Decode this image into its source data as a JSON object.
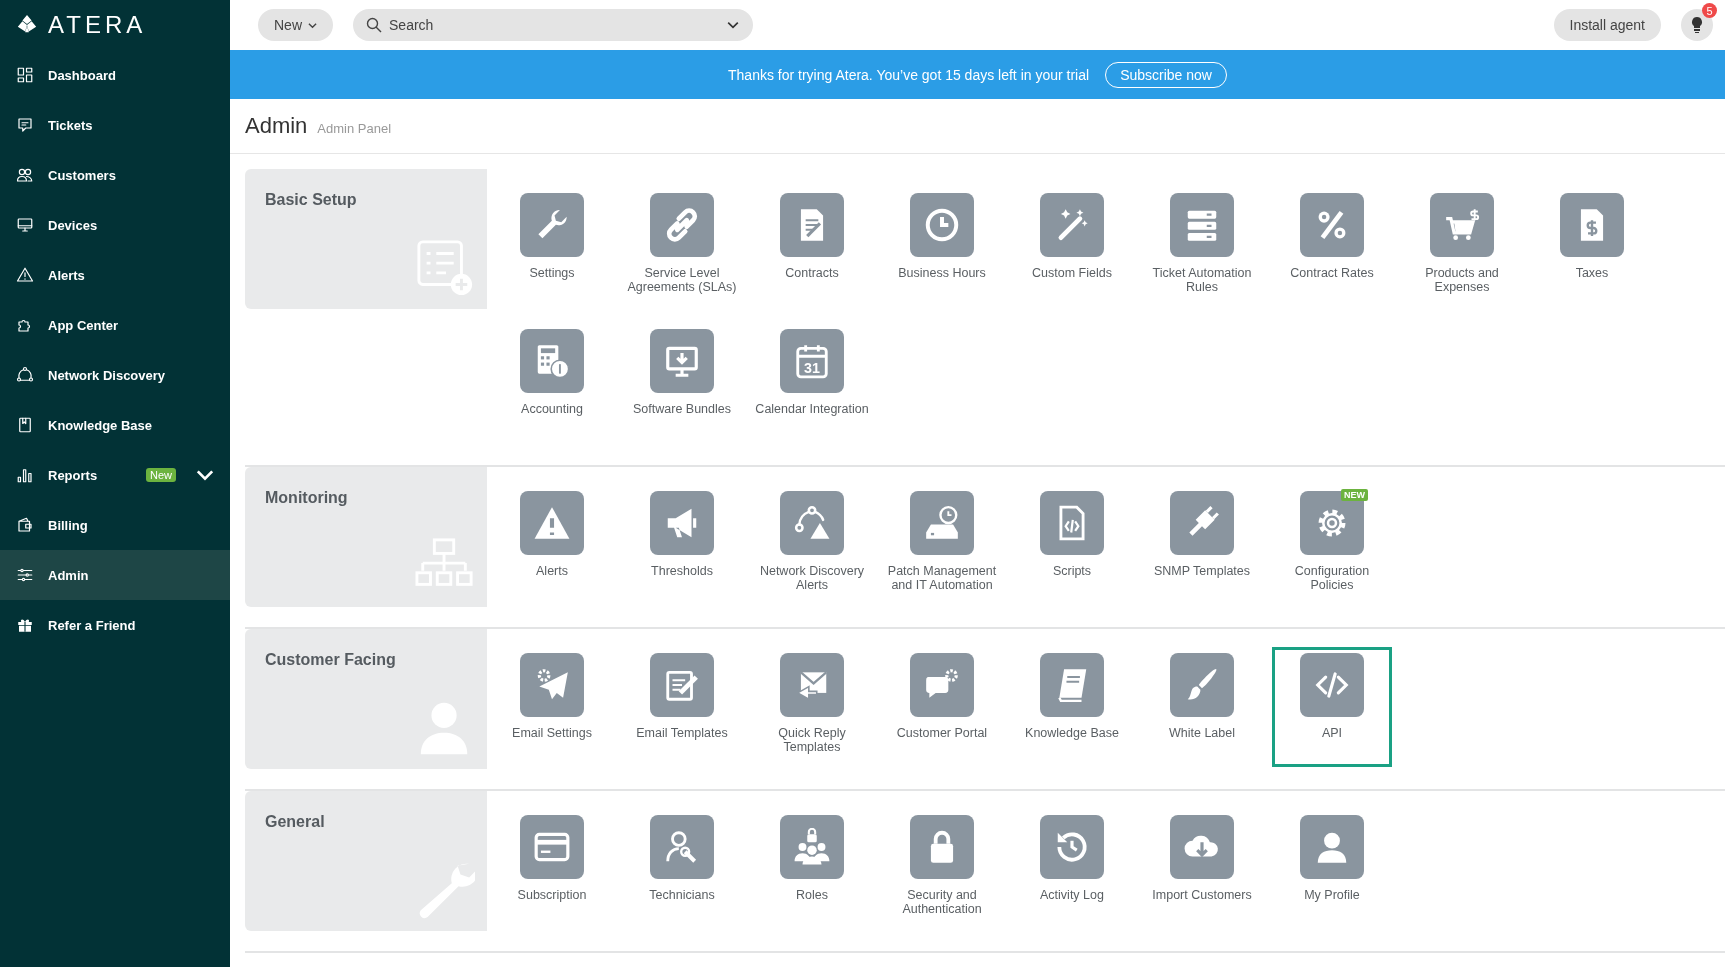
{
  "logo": "ATERA",
  "sidebar": {
    "items": [
      {
        "label": "Dashboard",
        "selected": false
      },
      {
        "label": "Tickets",
        "selected": false
      },
      {
        "label": "Customers",
        "selected": false
      },
      {
        "label": "Devices",
        "selected": false
      },
      {
        "label": "Alerts",
        "selected": false
      },
      {
        "label": "App Center",
        "selected": false
      },
      {
        "label": "Network Discovery",
        "selected": false
      },
      {
        "label": "Knowledge Base",
        "selected": false
      },
      {
        "label": "Reports",
        "selected": false,
        "badge": "New",
        "expandable": true
      },
      {
        "label": "Billing",
        "selected": false
      },
      {
        "label": "Admin",
        "selected": true
      },
      {
        "label": "Refer a Friend",
        "selected": false
      }
    ]
  },
  "top_bar": {
    "new_button": "New",
    "search": {
      "placeholder": "Search"
    },
    "install_button": "Install agent",
    "notification_count": "5"
  },
  "banner": {
    "message": "Thanks for trying Atera. You’ve got 15 days left in your trial",
    "button": "Subscribe now"
  },
  "page": {
    "title": "Admin",
    "subtitle": "Admin Panel"
  },
  "sections": [
    {
      "title": "Basic Setup",
      "tiles": [
        {
          "label": "Settings",
          "selected": false
        },
        {
          "label": "Service Level Agreements (SLAs)",
          "selected": false
        },
        {
          "label": "Contracts",
          "selected": false
        },
        {
          "label": "Business Hours",
          "selected": false
        },
        {
          "label": "Custom Fields",
          "selected": false
        },
        {
          "label": "Ticket Automation Rules",
          "selected": false
        },
        {
          "label": "Contract Rates",
          "selected": false
        },
        {
          "label": "Products and Expenses",
          "selected": false
        },
        {
          "label": "Taxes",
          "selected": false
        },
        {
          "label": "Accounting",
          "selected": false
        },
        {
          "label": "Software Bundles",
          "selected": false
        },
        {
          "label": "Calendar Integration",
          "selected": false,
          "icon_text": "31"
        }
      ]
    },
    {
      "title": "Monitoring",
      "tiles": [
        {
          "label": "Alerts",
          "selected": false
        },
        {
          "label": "Thresholds",
          "selected": false
        },
        {
          "label": "Network Discovery Alerts",
          "selected": false
        },
        {
          "label": "Patch Management and IT Automation",
          "selected": false
        },
        {
          "label": "Scripts",
          "selected": false
        },
        {
          "label": "SNMP Templates",
          "selected": false
        },
        {
          "label": "Configuration Policies",
          "selected": false,
          "badge": "NEW"
        }
      ]
    },
    {
      "title": "Customer Facing",
      "tiles": [
        {
          "label": "Email Settings",
          "selected": false
        },
        {
          "label": "Email Templates",
          "selected": false
        },
        {
          "label": "Quick Reply Templates",
          "selected": false
        },
        {
          "label": "Customer Portal",
          "selected": false
        },
        {
          "label": "Knowledge Base",
          "selected": false
        },
        {
          "label": "White Label",
          "selected": false
        },
        {
          "label": "API",
          "selected": true
        }
      ]
    },
    {
      "title": "General",
      "tiles": [
        {
          "label": "Subscription",
          "selected": false
        },
        {
          "label": "Technicians",
          "selected": false
        },
        {
          "label": "Roles",
          "selected": false
        },
        {
          "label": "Security and Authentication",
          "selected": false
        },
        {
          "label": "Activity Log",
          "selected": false
        },
        {
          "label": "Import Customers",
          "selected": false
        },
        {
          "label": "My Profile",
          "selected": false
        }
      ]
    }
  ]
}
